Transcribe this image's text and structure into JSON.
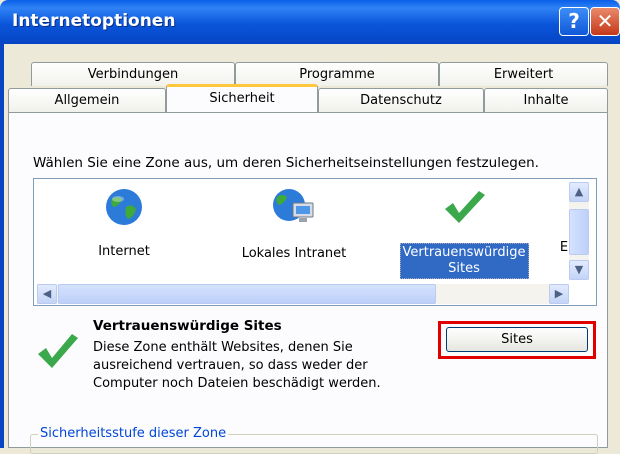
{
  "window": {
    "title": "Internetoptionen",
    "help": "?",
    "close": "✕"
  },
  "tabs": {
    "row1": [
      "Verbindungen",
      "Programme",
      "Erweitert"
    ],
    "row2": [
      "Allgemein",
      "Sicherheit",
      "Datenschutz",
      "Inhalte"
    ],
    "active": "Sicherheit"
  },
  "zones": {
    "instruction": "Wählen Sie eine Zone aus, um deren Sicherheitseinstellungen festzulegen.",
    "items": [
      {
        "label": "Internet",
        "icon": "globe-icon"
      },
      {
        "label": "Lokales Intranet",
        "icon": "intranet-icon"
      },
      {
        "label_line1": "Vertrauenswürdige",
        "label_line2": "Sites",
        "icon": "checkmark-icon",
        "selected": true
      },
      {
        "label": "E",
        "icon": "restricted-icon"
      }
    ]
  },
  "selected_zone": {
    "title": "Vertrauenswürdige Sites",
    "description": "Diese Zone enthält Websites, denen Sie ausreichend vertrauen, so dass weder der Computer noch Dateien beschädigt werden.",
    "sites_button": "Sites"
  },
  "security_level": {
    "group_title": "Sicherheitsstufe dieser Zone"
  },
  "colors": {
    "title_bar": "#0A55DA",
    "highlight": "#E00000",
    "selection": "#316AC5"
  }
}
